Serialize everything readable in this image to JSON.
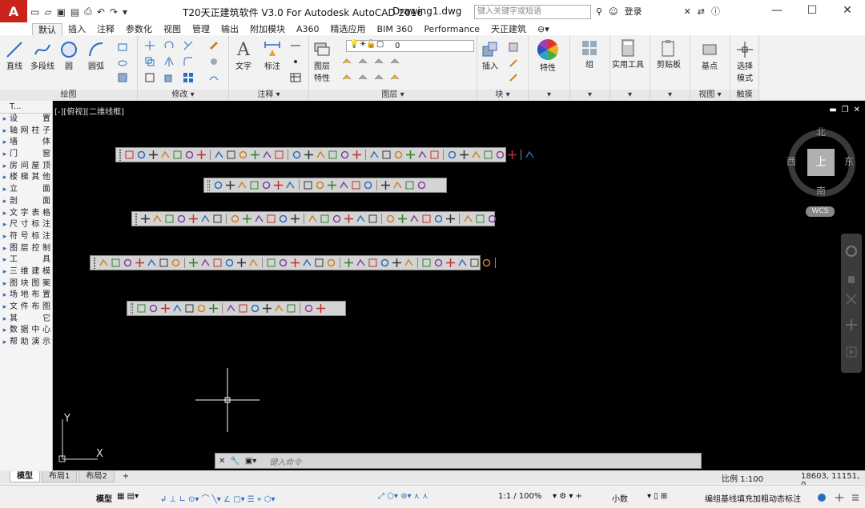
{
  "titlebar": {
    "app_title": "T20天正建筑软件 V3.0 For Autodesk AutoCAD 2016",
    "doc_title": "Drawing1.dwg",
    "search_placeholder": "键入关键字或短语",
    "login": "登录"
  },
  "ribbon_tabs": [
    "默认",
    "插入",
    "注释",
    "参数化",
    "视图",
    "管理",
    "输出",
    "附加模块",
    "A360",
    "精选应用",
    "BIM 360",
    "Performance",
    "天正建筑"
  ],
  "ribbon": {
    "draw": {
      "title": "绘图",
      "buttons": [
        "直线",
        "多段线",
        "圆",
        "圆弧"
      ]
    },
    "modify": {
      "title": "修改"
    },
    "annotation": {
      "title": "注释",
      "buttons": [
        "文字",
        "标注"
      ]
    },
    "layers": {
      "title": "图层",
      "button": "图层\n特性",
      "current_layer": "0"
    },
    "block": {
      "title": "块",
      "button": "插入"
    },
    "properties": {
      "button": "特性"
    },
    "group": {
      "button": "组"
    },
    "utilities": {
      "button": "实用工具"
    },
    "clipboard": {
      "button": "剪贴板"
    },
    "view": {
      "title": "视图",
      "button": "基点"
    },
    "touch": {
      "title": "触摸",
      "button": "选择\n模式"
    }
  },
  "palette": {
    "header": "T...",
    "items": [
      "设　置",
      "轴网柱子",
      "墙　体",
      "门　窗",
      "房间屋顶",
      "楼梯其他",
      "立　面",
      "剖　面",
      "文字表格",
      "尺寸标注",
      "符号标注",
      "图层控制",
      "工　具",
      "三维建模",
      "图块图案",
      "场地布置",
      "文件布图",
      "其　它",
      "数据中心",
      "帮助演示"
    ]
  },
  "viewport": {
    "label": "[-][俯视][二维线框]",
    "compass": {
      "north": "北",
      "south": "南",
      "east": "东",
      "west": "西",
      "top": "上"
    },
    "wcs": "WCS",
    "ucs_x": "X",
    "ucs_y": "Y"
  },
  "cmdline": {
    "placeholder": "键入命令"
  },
  "layout_tabs": [
    "模型",
    "布局1",
    "布局2"
  ],
  "status": {
    "scale": "比例 1:100",
    "coords": "18603, 11151, 0",
    "model": "模型",
    "annoscale": "1:1 / 100%",
    "units": "小数",
    "message": "编组基线填充加粗动态标注"
  }
}
